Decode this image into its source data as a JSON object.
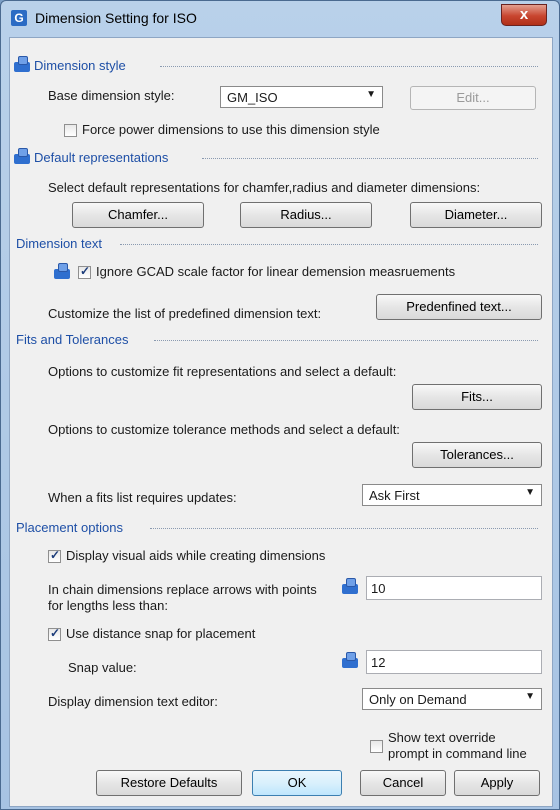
{
  "window": {
    "title": "Dimension Setting for ISO",
    "close": "x"
  },
  "dimension_style": {
    "header": "Dimension style",
    "base_label": "Base dimension style:",
    "base_value": "GM_ISO",
    "edit_button": "Edit...",
    "force_label": "Force power dimensions to use this dimension style",
    "force_checked": false
  },
  "default_representations": {
    "header": "Default representations",
    "description": "Select default representations for chamfer,radius and diameter dimensions:",
    "chamfer_button": "Chamfer...",
    "radius_button": "Radius...",
    "diameter_button": "Diameter..."
  },
  "dimension_text": {
    "header": "Dimension text",
    "ignore_label": "Ignore GCAD scale factor for linear demension measruements",
    "ignore_checked": true,
    "customize_label": "Customize the list of predefined dimension text:",
    "predefined_button": "Predenfined text..."
  },
  "fits_tolerances": {
    "header": "Fits and Tolerances",
    "fits_label": "Options to customize fit representations and select a default:",
    "fits_button": "Fits...",
    "tol_label": "Options to customize tolerance methods and select a default:",
    "tol_button": "Tolerances...",
    "update_label": "When a fits list requires updates:",
    "update_value": "Ask First"
  },
  "placement": {
    "header": "Placement options",
    "visual_aids_label": "Display visual aids while creating dimensions",
    "visual_aids_checked": true,
    "chain_label_1": "In chain dimensions replace arrows with points",
    "chain_label_2": "for lengths less than:",
    "chain_value": "10",
    "snap_label": "Use distance snap for placement",
    "snap_checked": true,
    "snap_value_label": "Snap value:",
    "snap_value": "12",
    "editor_label": "Display dimension text editor:",
    "editor_value": "Only on Demand",
    "override_label_1": "Show text override",
    "override_label_2": "prompt in command line",
    "override_checked": false
  },
  "footer": {
    "restore": "Restore Defaults",
    "ok": "OK",
    "cancel": "Cancel",
    "apply": "Apply"
  }
}
